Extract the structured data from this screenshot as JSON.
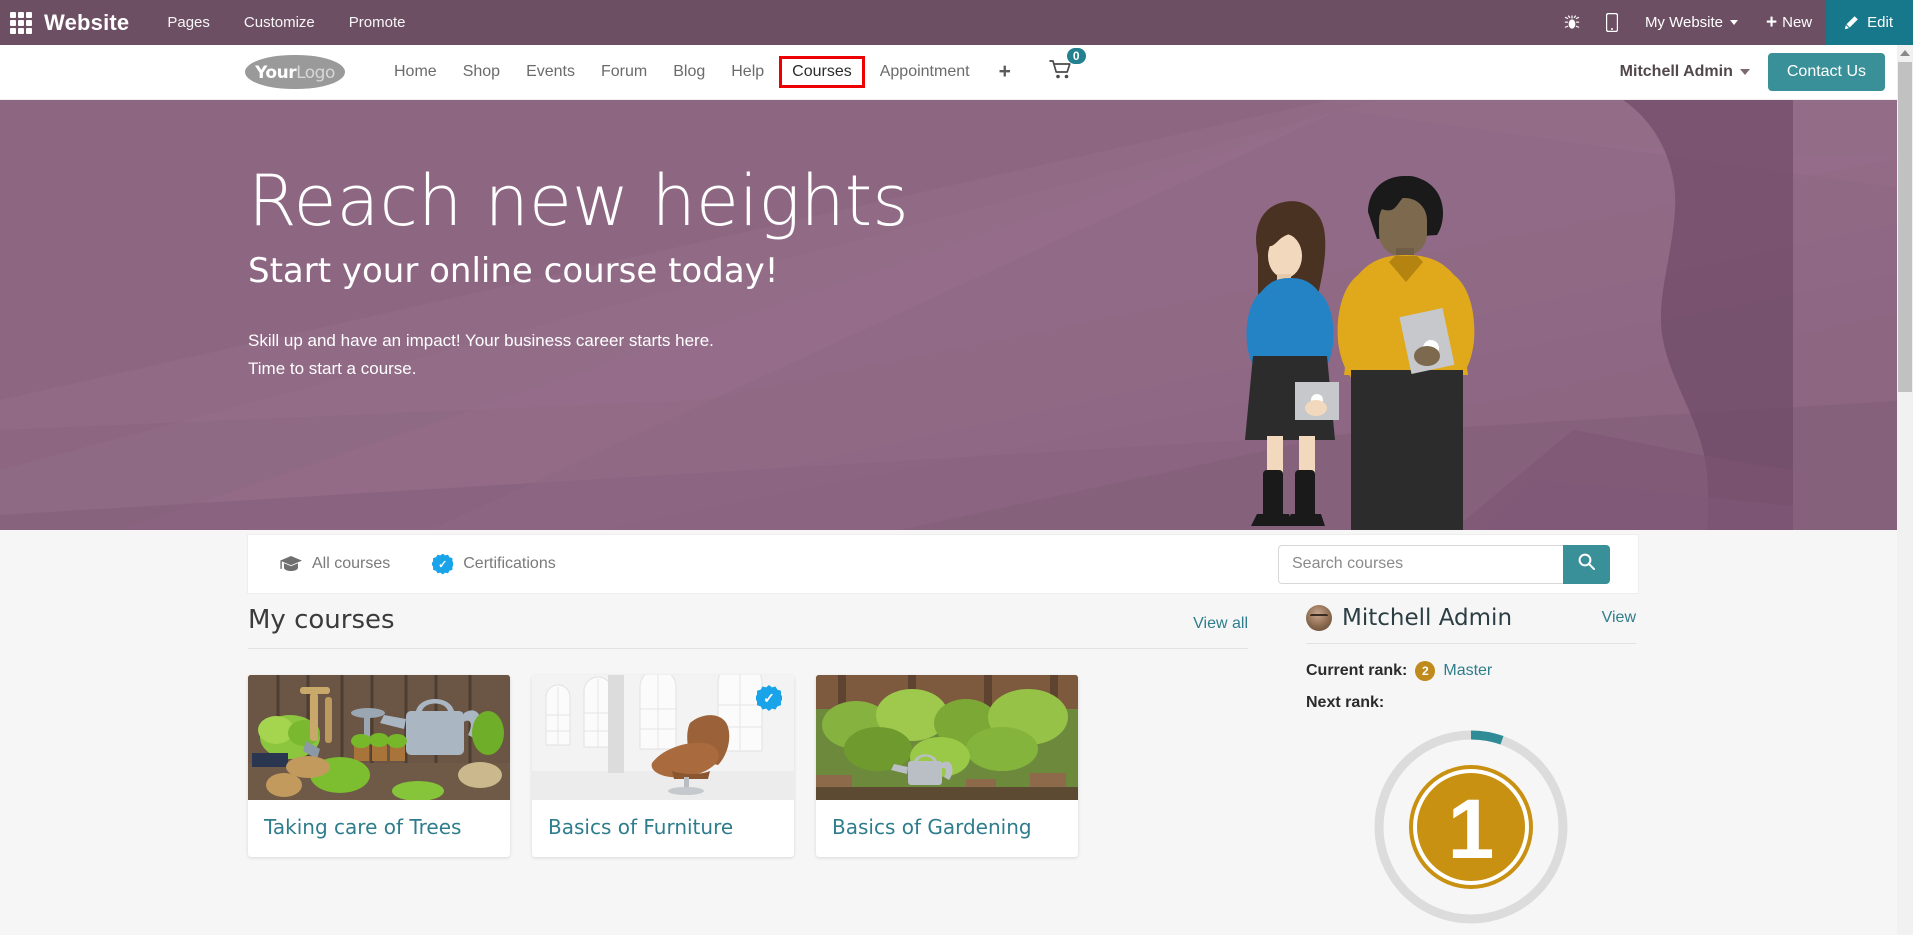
{
  "odoo_bar": {
    "apps_icon": "apps-grid-icon",
    "app_name": "Website",
    "menus": [
      "Pages",
      "Customize",
      "Promote"
    ],
    "debug_icon": "bug-icon",
    "mobile_icon": "mobile-preview-icon",
    "website_selector": "My Website",
    "new_label": "New",
    "new_icon": "plus-icon",
    "edit_label": "Edit",
    "edit_icon": "pencil-icon",
    "bg_color": "#6c4f63",
    "edit_bg_color": "#17788b"
  },
  "site_header": {
    "logo_text_bold": "Your",
    "logo_text_light": "Logo",
    "nav": [
      {
        "label": "Home",
        "active": false
      },
      {
        "label": "Shop",
        "active": false
      },
      {
        "label": "Events",
        "active": false
      },
      {
        "label": "Forum",
        "active": false
      },
      {
        "label": "Blog",
        "active": false
      },
      {
        "label": "Help",
        "active": false
      },
      {
        "label": "Courses",
        "active": true
      },
      {
        "label": "Appointment",
        "active": false
      }
    ],
    "add_page_icon": "plus-icon",
    "cart_icon": "shopping-cart-icon",
    "cart_count": "0",
    "user_name": "Mitchell Admin",
    "contact_label": "Contact Us",
    "highlight_color": "#ef0000",
    "accent_color": "#3a9098"
  },
  "hero": {
    "title": "Reach new heights",
    "subtitle": "Start your online course today!",
    "paragraph_line1": "Skill up and have an impact! Your business career starts here.",
    "paragraph_line2": "Time to start a course.",
    "bg_color": "#8d6682"
  },
  "course_panel": {
    "tabs": [
      {
        "label": "All courses",
        "icon": "graduation-cap-icon"
      },
      {
        "label": "Certifications",
        "icon": "certification-badge-icon"
      }
    ],
    "search_placeholder": "Search courses",
    "search_value": "",
    "search_icon": "search-icon"
  },
  "my_courses": {
    "heading": "My courses",
    "view_all": "View all",
    "cards": [
      {
        "title": "Taking care of Trees",
        "image": "garden-tools-photo",
        "certified": false
      },
      {
        "title": "Basics of Furniture",
        "image": "loft-chair-photo",
        "certified": true
      },
      {
        "title": "Basics of Gardening",
        "image": "potted-plants-photo",
        "certified": false
      }
    ]
  },
  "profile": {
    "name": "Mitchell Admin",
    "view_label": "View",
    "avatar_icon": "user-avatar",
    "current_rank_label": "Current rank:",
    "current_rank_value": "Master",
    "current_rank_medal": "2",
    "next_rank_label": "Next rank:",
    "next_rank_number": "1",
    "medal_color": "#c08b1c",
    "progress_color": "#2f8c96"
  }
}
